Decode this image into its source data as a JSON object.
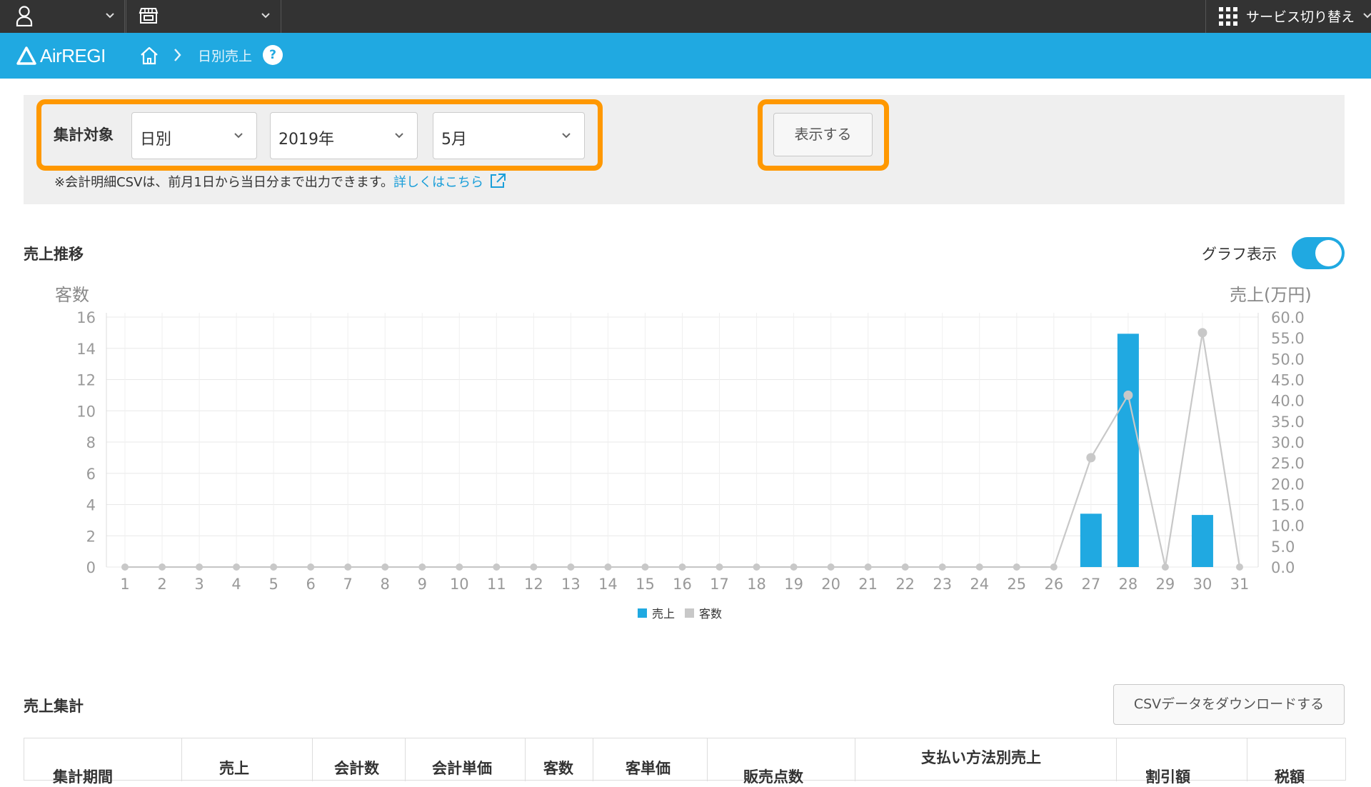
{
  "topbar": {
    "service_switch_label": "サービス切り替え"
  },
  "header": {
    "logo_text": "AirREGI",
    "breadcrumb_page": "日別売上"
  },
  "filter": {
    "label": "集計対象",
    "period_type": "日別",
    "year": "2019年",
    "month": "5月",
    "show_button": "表示する",
    "note_text": "※会計明細CSVは、前月1日から当日分まで出力できます。",
    "note_link": "詳しくはこちら"
  },
  "chart_section": {
    "title": "売上推移",
    "graph_toggle_label": "グラフ表示",
    "graph_toggle_on": true
  },
  "chart_data": {
    "type": "bar",
    "categories": [
      "1",
      "2",
      "3",
      "4",
      "5",
      "6",
      "7",
      "8",
      "9",
      "10",
      "11",
      "12",
      "13",
      "14",
      "15",
      "16",
      "17",
      "18",
      "19",
      "20",
      "21",
      "22",
      "23",
      "24",
      "25",
      "26",
      "27",
      "28",
      "29",
      "30",
      "31"
    ],
    "y_left_label": "客数",
    "y_right_label": "売上(万円)",
    "y_left_ticks": [
      "0",
      "2",
      "4",
      "6",
      "8",
      "10",
      "12",
      "14",
      "16"
    ],
    "y_right_ticks": [
      "0.0",
      "5.0",
      "10.0",
      "15.0",
      "20.0",
      "25.0",
      "30.0",
      "35.0",
      "40.0",
      "45.0",
      "50.0",
      "55.0",
      "60.0"
    ],
    "ylim_left": [
      0,
      16
    ],
    "ylim_right": [
      0,
      60
    ],
    "series": [
      {
        "name": "売上",
        "type": "bar",
        "axis": "right",
        "color": "#20a9e1",
        "values": [
          0,
          0,
          0,
          0,
          0,
          0,
          0,
          0,
          0,
          0,
          0,
          0,
          0,
          0,
          0,
          0,
          0,
          0,
          0,
          0,
          0,
          0,
          0,
          0,
          0,
          0,
          12.8,
          56,
          0,
          12.5,
          0
        ]
      },
      {
        "name": "客数",
        "type": "line",
        "axis": "left",
        "color": "#c8c8c8",
        "values": [
          0,
          0,
          0,
          0,
          0,
          0,
          0,
          0,
          0,
          0,
          0,
          0,
          0,
          0,
          0,
          0,
          0,
          0,
          0,
          0,
          0,
          0,
          0,
          0,
          0,
          0,
          7,
          11,
          0,
          15,
          0
        ]
      }
    ],
    "grid": true,
    "legend_position": "bottom-center"
  },
  "summary": {
    "title": "売上集計",
    "csv_button": "CSVデータをダウンロードする",
    "partial_headers": [
      "集計期間",
      "売上",
      "会計数",
      "会計単価",
      "客数",
      "客単価",
      "販売点数",
      "支払い方法別売上",
      "割引額",
      "税額"
    ]
  }
}
